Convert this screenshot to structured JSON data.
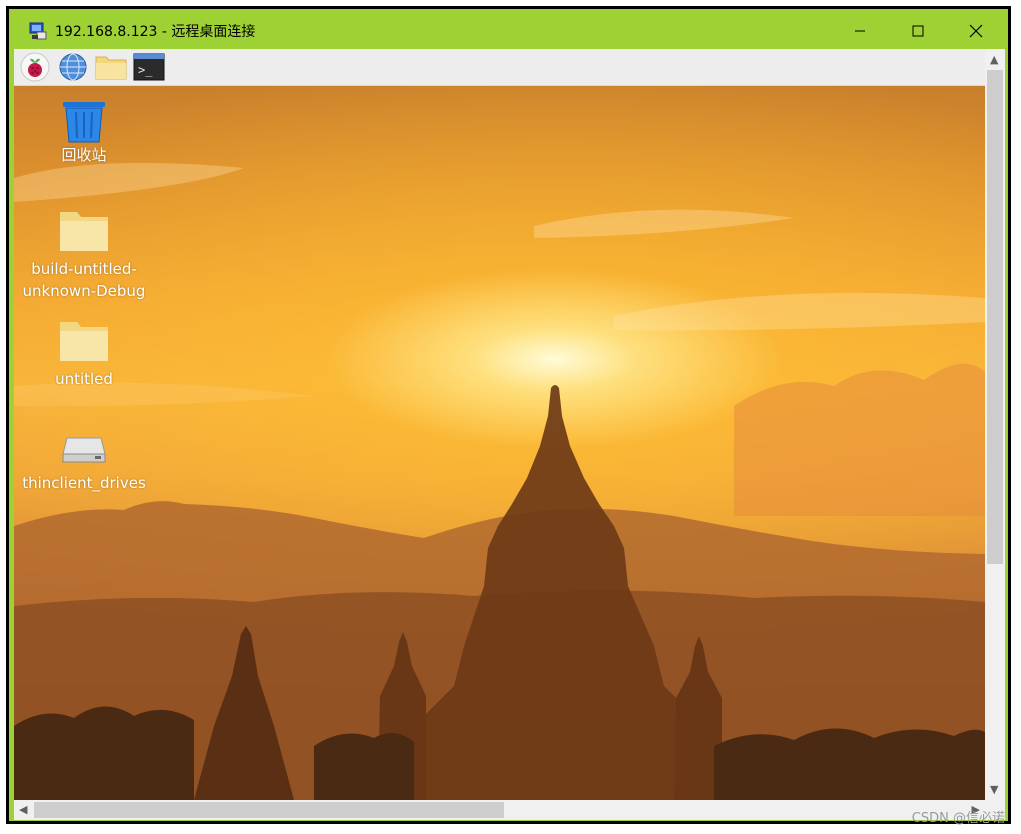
{
  "window": {
    "title": "192.168.8.123 - 远程桌面连接",
    "minimize_icon": "minimize-icon",
    "maximize_icon": "maximize-icon",
    "close_icon": "close-icon"
  },
  "panel": {
    "items": [
      {
        "name": "raspberry-menu",
        "icon": "raspberry-icon"
      },
      {
        "name": "web-browser",
        "icon": "globe-icon"
      },
      {
        "name": "file-manager",
        "icon": "folder-icon"
      },
      {
        "name": "terminal",
        "icon": "terminal-icon",
        "glyph": ">_"
      }
    ]
  },
  "desktop": {
    "icons": [
      {
        "label": "回收站",
        "icon": "trash-icon"
      },
      {
        "label": "build-untitled-unknown-Debug",
        "line1": "build-untitled-",
        "line2": "unknown-Debug",
        "icon": "folder-icon"
      },
      {
        "label": "untitled",
        "icon": "folder-icon"
      },
      {
        "label": "thinclient_drives",
        "icon": "drive-icon"
      }
    ]
  },
  "watermark": "CSDN @信必诺",
  "colors": {
    "titlebar": "#9ed134",
    "folder": "#f7e08f"
  }
}
